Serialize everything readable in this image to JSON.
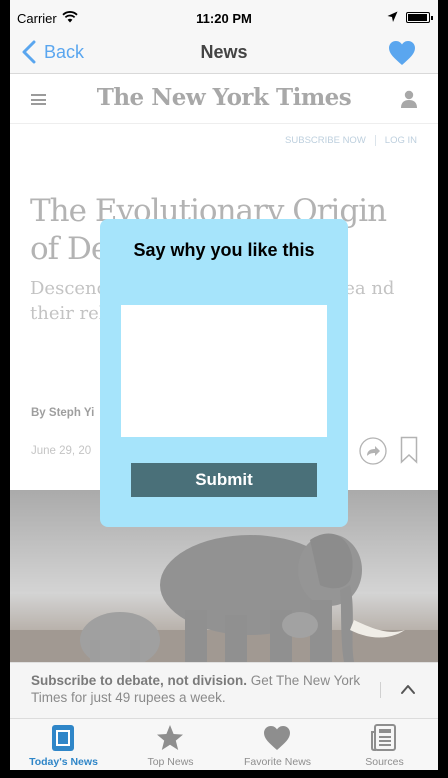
{
  "status_bar": {
    "carrier": "Carrier",
    "time": "11:20 PM"
  },
  "nav": {
    "back_label": "Back",
    "title": "News"
  },
  "article": {
    "logo": "The New York Times",
    "subscribe_label": "SUBSCRIBE NOW",
    "login_label": "LOG IN",
    "headline": "The Evolutionary Origin of De",
    "summary": "Descenc                                  nt in the earliest r                                  disappea                              nd their relatives",
    "byline": "By Steph Yi",
    "date": "June 29, 20"
  },
  "modal": {
    "title": "Say why you like this",
    "input_value": "",
    "submit_label": "Submit"
  },
  "banner": {
    "bold_text": "Subscribe to debate, not division.",
    "text": " Get The New York Times for just 49 rupees a week."
  },
  "tabs": [
    {
      "label": "Today's News",
      "icon": "news-icon",
      "active": true
    },
    {
      "label": "Top News",
      "icon": "star-icon",
      "active": false
    },
    {
      "label": "Favorite News",
      "icon": "heart-icon",
      "active": false
    },
    {
      "label": "Sources",
      "icon": "newspaper-icon",
      "active": false
    }
  ],
  "colors": {
    "accent": "#5aa6ef",
    "modal_bg": "#a6e4fb",
    "submit_bg": "#4a7079",
    "tab_active": "#2f86c8"
  }
}
